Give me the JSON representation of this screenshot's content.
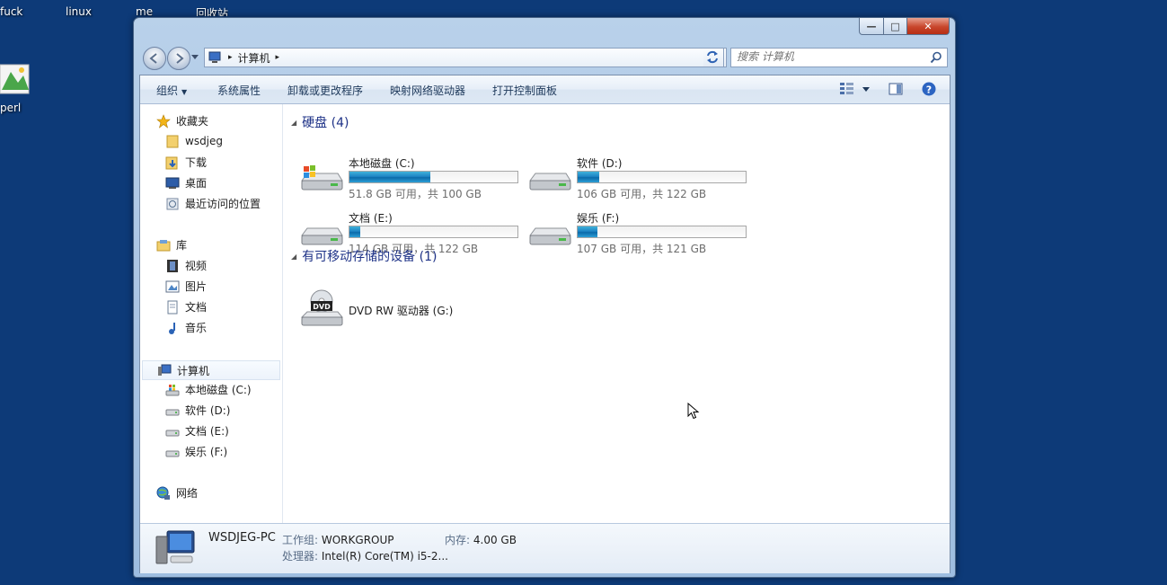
{
  "desktop": {
    "icons": [
      {
        "label": "fuck"
      },
      {
        "label": "linux"
      },
      {
        "label": "me"
      },
      {
        "label": "回收站"
      },
      {
        "label": "perl"
      }
    ]
  },
  "window": {
    "caption_buttons": {
      "minimize": "—",
      "maximize": "□",
      "close": "✕"
    },
    "address": {
      "root_icon": "computer-icon",
      "crumb": "计算机"
    },
    "search": {
      "placeholder": "搜索 计算机"
    },
    "toolbar": {
      "organize": "组织",
      "system_properties": "系统属性",
      "uninstall": "卸载或更改程序",
      "map_drive": "映射网络驱动器",
      "control_panel": "打开控制面板"
    },
    "nav": {
      "favorites": "收藏夹",
      "fav_items": [
        "wsdjeg",
        "下载",
        "桌面",
        "最近访问的位置"
      ],
      "libraries": "库",
      "lib_items": [
        "视频",
        "图片",
        "文档",
        "音乐"
      ],
      "computer": "计算机",
      "drive_items": [
        "本地磁盘 (C:)",
        "软件 (D:)",
        "文档 (E:)",
        "娱乐 (F:)"
      ],
      "network": "网络"
    },
    "groups": {
      "hard_disks": "硬盘 (4)",
      "removable": "有可移动存储的设备 (1)"
    },
    "drives": [
      {
        "name": "本地磁盘 (C:)",
        "info": "51.8 GB 可用，共 100 GB",
        "used_fraction": 0.482
      },
      {
        "name": "软件 (D:)",
        "info": "106 GB 可用，共 122 GB",
        "used_fraction": 0.131
      },
      {
        "name": "文档 (E:)",
        "info": "114 GB 可用，共 122 GB",
        "used_fraction": 0.066
      },
      {
        "name": "娱乐 (F:)",
        "info": "107 GB 可用，共 121 GB",
        "used_fraction": 0.116
      }
    ],
    "dvd": {
      "name": "DVD RW 驱动器 (G:)",
      "badge": "DVD"
    },
    "details": {
      "pc_name": "WSDJEG-PC",
      "workgroup_label": "工作组:",
      "workgroup": "WORKGROUP",
      "memory_label": "内存:",
      "memory": "4.00 GB",
      "cpu_label": "处理器:",
      "cpu": "Intel(R) Core(TM) i5-2..."
    }
  }
}
